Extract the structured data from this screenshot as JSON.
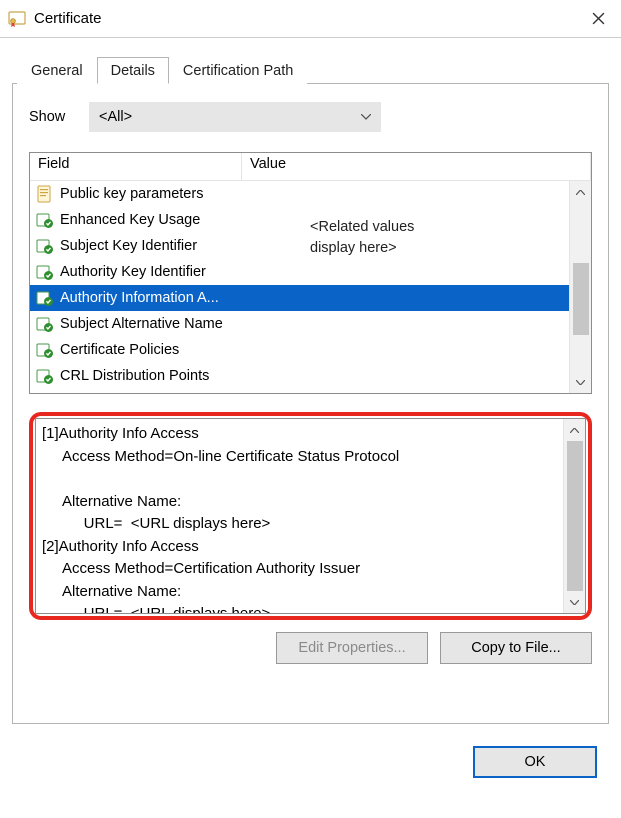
{
  "window": {
    "title": "Certificate"
  },
  "tabs": [
    {
      "label": "General",
      "active": false
    },
    {
      "label": "Details",
      "active": true
    },
    {
      "label": "Certification Path",
      "active": false
    }
  ],
  "show": {
    "label": "Show",
    "value": "<All>"
  },
  "listHeaders": {
    "field": "Field",
    "value": "Value"
  },
  "fields": [
    {
      "icon": "doc",
      "label": "Public key parameters"
    },
    {
      "icon": "ext",
      "label": "Enhanced Key Usage"
    },
    {
      "icon": "ext",
      "label": "Subject Key Identifier"
    },
    {
      "icon": "ext",
      "label": "Authority Key Identifier"
    },
    {
      "icon": "ext",
      "label": "Authority Information A...",
      "selected": true
    },
    {
      "icon": "ext",
      "label": "Subject Alternative Name"
    },
    {
      "icon": "ext",
      "label": "Certificate Policies"
    },
    {
      "icon": "ext",
      "label": "CRL Distribution Points"
    }
  ],
  "valuePlaceholder": "<Related values\ndisplay here>",
  "detailText": "[1]Authority Info Access\n     Access Method=On-line Certificate Status Protocol\n\n     Alternative Name:\n          URL=  <URL displays here>\n[2]Authority Info Access\n     Access Method=Certification Authority Issuer\n     Alternative Name:\n          URL=  <URL displays here>",
  "buttons": {
    "editProperties": "Edit Properties...",
    "copyToFile": "Copy to File...",
    "ok": "OK"
  }
}
